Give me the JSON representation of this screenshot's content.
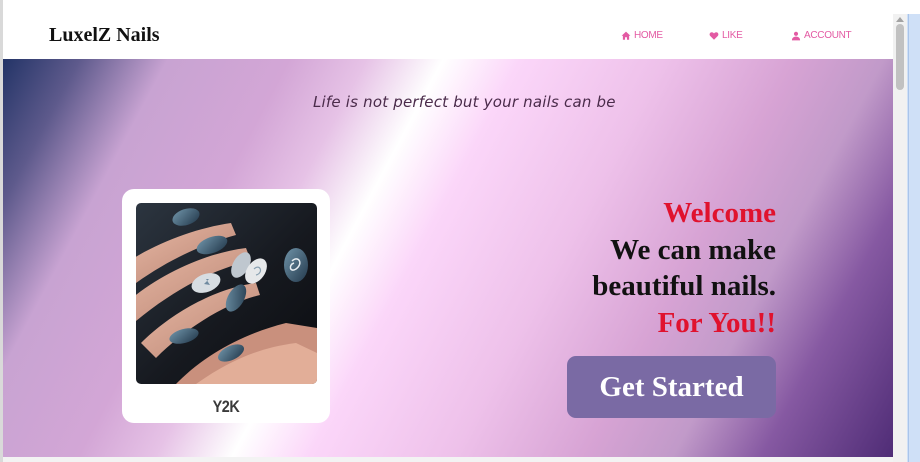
{
  "navbar": {
    "brand": "LuxelZ Nails",
    "items": [
      {
        "label": "HOME",
        "icon": "home-icon"
      },
      {
        "label": "LIKE",
        "icon": "heart-icon"
      },
      {
        "label": "ACCOUNT",
        "icon": "user-icon"
      }
    ],
    "accent_color": "#e35aa3"
  },
  "hero": {
    "tagline": "Life is not perfect but your nails can be",
    "card": {
      "label": "Y2K",
      "image": "nail-art-photo"
    },
    "headline": {
      "line1": "Welcome",
      "line2": "We can make",
      "line3": "beautiful nails.",
      "line4": "For You!!"
    },
    "cta_label": "Get Started",
    "colors": {
      "headline_red": "#e0122e",
      "cta_background": "#7a6aa4"
    }
  }
}
